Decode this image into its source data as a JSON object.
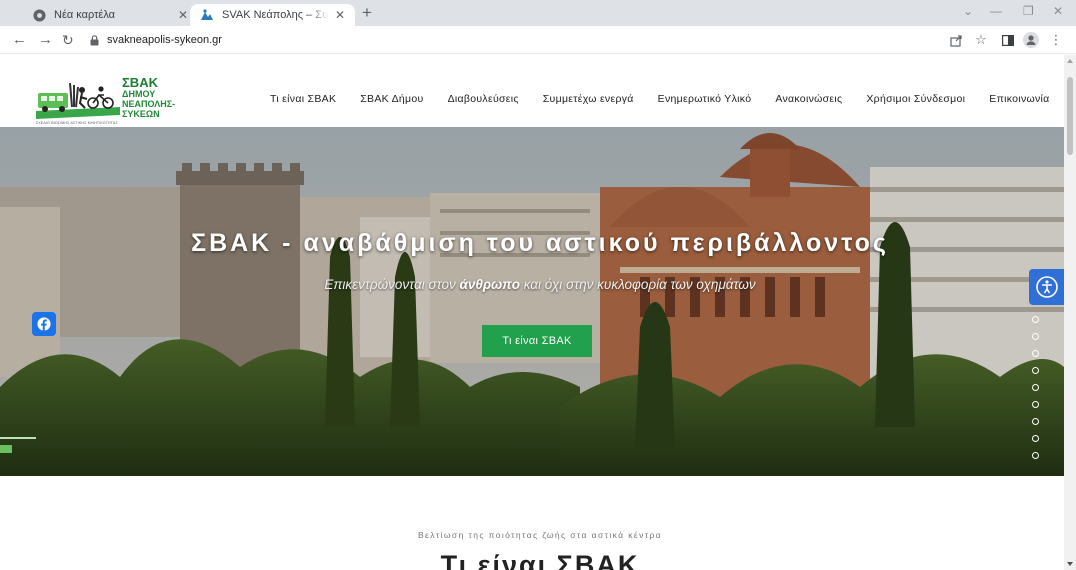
{
  "browser": {
    "tabs": [
      {
        "title": "Νέα καρτέλα",
        "active": false
      },
      {
        "title": "SVAK Νεάπολης – Συκεών – SVAK",
        "active": true
      }
    ],
    "url": "svakneapolis-sykeon.gr",
    "icons": [
      "back-arrow-icon",
      "forward-arrow-icon",
      "reload-icon",
      "lock-icon",
      "share-icon",
      "star-icon",
      "sidebar-icon",
      "profile-icon",
      "menu-icon"
    ]
  },
  "site": {
    "logo": {
      "line1": "ΣΒΑΚ",
      "line2": "ΔΗΜΟΥ",
      "line3": "ΝΕΑΠΟΛΗΣ-",
      "line4": "ΣΥΚΕΩΝ",
      "caption": "ΣΧΕΔΙΟ ΒΙΩΣΙΜΗΣ ΑΣΤΙΚΗΣ ΚΙΝΗΤΙΚΟΤΗΤΑΣ"
    },
    "nav": [
      "Τι είναι ΣΒΑΚ",
      "ΣΒΑΚ Δήμου",
      "Διαβουλεύσεις",
      "Συμμετέχω ενεργά",
      "Ενημερωτικό Υλικό",
      "Ανακοινώσεις",
      "Χρήσιμοι Σύνδεσμοι",
      "Επικοινωνία"
    ]
  },
  "hero": {
    "title": "ΣΒΑΚ - αναβάθμιση του αστικού περιβάλλοντος",
    "subtitle_pre": "Επικεντρώνονται στον ",
    "subtitle_bold": "άνθρωπο",
    "subtitle_post": " και όχι στην κυκλοφορία των οχημάτων",
    "cta": "Τι είναι ΣΒΑΚ",
    "slides": 9,
    "colors": {
      "cta": "#21a04d",
      "accessibility": "#2f6fd6",
      "facebook": "#1a73e8"
    }
  },
  "section": {
    "tagline": "Βελτίωση της ποιότητας ζωής στα αστικά κέντρα",
    "title": "Τι είναι ΣΒΑΚ"
  }
}
